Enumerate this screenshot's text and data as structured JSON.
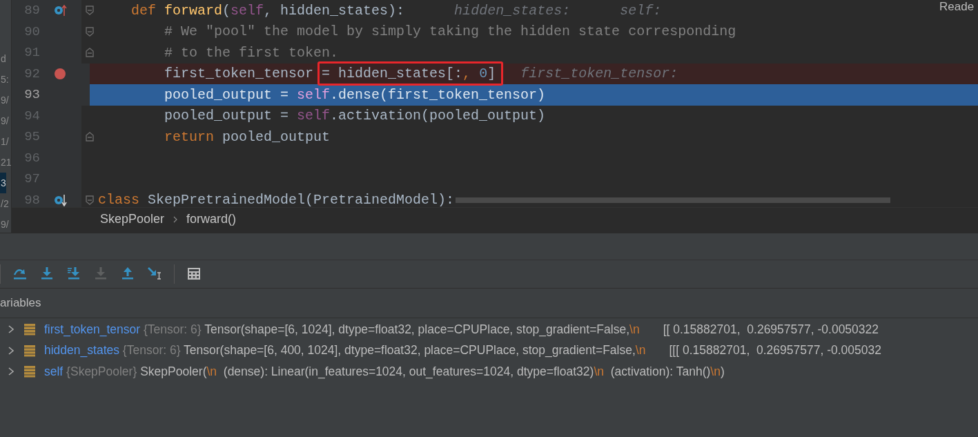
{
  "side_fragments": [
    {
      "text": "d",
      "selected": false
    },
    {
      "text": "5:",
      "selected": false
    },
    {
      "text": "9/",
      "selected": false
    },
    {
      "text": "9/",
      "selected": false
    },
    {
      "text": "1/",
      "selected": false
    },
    {
      "text": "21",
      "selected": false
    },
    {
      "text": "3",
      "selected": true
    },
    {
      "text": "/2",
      "selected": false
    },
    {
      "text": "9/",
      "selected": false
    }
  ],
  "corner_label": "Reade",
  "editor": {
    "lines": [
      {
        "number": "89",
        "kind": "normal",
        "gutter_icons": [
          {
            "kind": "override"
          },
          {
            "kind": "fold-start"
          }
        ],
        "tokens": [
          {
            "t": "    def",
            "kind": "kw"
          },
          {
            "t": " forward",
            "kind": "fn"
          },
          {
            "t": "(",
            "kind": "plain"
          },
          {
            "t": "self",
            "kind": "self"
          },
          {
            "t": ", hidden_states):",
            "kind": "plain"
          },
          {
            "t": "      hidden_states:",
            "kind": "hint"
          },
          {
            "t": "      self:",
            "kind": "hint"
          }
        ]
      },
      {
        "number": "90",
        "kind": "normal",
        "gutter_icons": [
          {
            "kind": "fold-start"
          }
        ],
        "tokens": [
          {
            "t": "        # We \"pool\" the model by simply taking the hidden state corresponding",
            "kind": "comment"
          }
        ]
      },
      {
        "number": "91",
        "kind": "normal",
        "gutter_icons": [
          {
            "kind": "fold-end"
          }
        ],
        "tokens": [
          {
            "t": "        # to the first token.",
            "kind": "comment"
          }
        ]
      },
      {
        "number": "92",
        "kind": "breakpoint",
        "tokens": [
          {
            "t": "        first_token_tensor ",
            "kind": "plain"
          }
        ],
        "boxed_tokens": [
          {
            "t": "= hidden_states[:",
            "kind": "plain"
          },
          {
            "t": ",",
            "kind": "kw"
          },
          {
            "t": " 0",
            "kind": "num"
          },
          {
            "t": "]",
            "kind": "plain"
          }
        ],
        "trailing_tokens": [
          {
            "t": "   first_token_tensor:",
            "kind": "hint"
          }
        ]
      },
      {
        "number": "93",
        "kind": "current",
        "tokens": [
          {
            "t": "        pooled_output = ",
            "kind": "plain"
          },
          {
            "t": "self",
            "kind": "self"
          },
          {
            "t": ".dense(first_token_tensor)",
            "kind": "plain"
          }
        ]
      },
      {
        "number": "94",
        "kind": "normal",
        "tokens": [
          {
            "t": "        pooled_output = ",
            "kind": "plain"
          },
          {
            "t": "self",
            "kind": "self"
          },
          {
            "t": ".activation(pooled_output)",
            "kind": "plain"
          }
        ]
      },
      {
        "number": "95",
        "kind": "normal",
        "gutter_icons": [
          {
            "kind": "fold-end"
          }
        ],
        "tokens": [
          {
            "t": "        return",
            "kind": "kw"
          },
          {
            "t": " pooled_output",
            "kind": "plain"
          }
        ]
      },
      {
        "number": "96",
        "kind": "normal"
      },
      {
        "number": "97",
        "kind": "normal"
      },
      {
        "number": "98",
        "kind": "normal",
        "gutter_icons": [
          {
            "kind": "implemented"
          },
          {
            "kind": "fold-start"
          }
        ],
        "tokens": [
          {
            "t": "class",
            "kind": "kw"
          },
          {
            "t": " SkepPretrainedModel(PretrainedModel):",
            "kind": "plain"
          }
        ]
      }
    ]
  },
  "breadcrumb": [
    "SkepPooler",
    "forward()"
  ],
  "toolbar": [
    {
      "kind": "step-over",
      "disabled": false
    },
    {
      "kind": "step-into",
      "disabled": false
    },
    {
      "kind": "step-into-my-code",
      "disabled": false
    },
    {
      "kind": "force-step-into",
      "disabled": true
    },
    {
      "kind": "step-out",
      "disabled": false
    },
    {
      "kind": "run-to-cursor",
      "disabled": false
    },
    {
      "kind": "evaluate",
      "disabled": false
    }
  ],
  "variables": {
    "title": "ariables",
    "rows": [
      {
        "name": "first_token_tensor",
        "type": "{Tensor: 6}",
        "value": [
          {
            "t": "Tensor(shape=[6, 1024], dtype=float32, place=CPUPlace, stop_gradient=False,",
            "kind": "plain"
          },
          {
            "t": "\\n",
            "kind": "escape"
          },
          {
            "t": "       [[ 0.15882701,  0.26957577, -0.0050322",
            "kind": "plain"
          }
        ]
      },
      {
        "name": "hidden_states",
        "type": "{Tensor: 6}",
        "value": [
          {
            "t": "Tensor(shape=[6, 400, 1024], dtype=float32, place=CPUPlace, stop_gradient=False,",
            "kind": "plain"
          },
          {
            "t": "\\n",
            "kind": "escape"
          },
          {
            "t": "       [[[ 0.15882701,  0.26957577, -0.005032",
            "kind": "plain"
          }
        ]
      },
      {
        "name": "self",
        "type": "{SkepPooler}",
        "value": [
          {
            "t": "SkepPooler(",
            "kind": "plain"
          },
          {
            "t": "\\n",
            "kind": "escape"
          },
          {
            "t": "  (dense): Linear(in_features=1024, out_features=1024, dtype=float32)",
            "kind": "plain"
          },
          {
            "t": "\\n",
            "kind": "escape"
          },
          {
            "t": "  (activation): Tanh()",
            "kind": "plain"
          },
          {
            "t": "\\n",
            "kind": "escape"
          },
          {
            "t": ")",
            "kind": "plain"
          }
        ]
      }
    ]
  }
}
